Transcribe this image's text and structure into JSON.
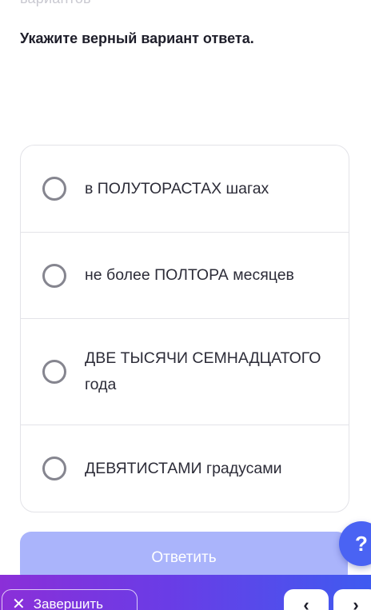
{
  "header": {
    "cut_text": "вариантов"
  },
  "question": {
    "prompt": "Укажите верный вариант ответа."
  },
  "answers": [
    {
      "label": "в ПОЛУТОРАСТАХ шагах"
    },
    {
      "label": "не более ПОЛТОРА месяцев"
    },
    {
      "label": "ДВЕ ТЫСЯЧИ СЕМНАДЦАТОГО года"
    },
    {
      "label": "ДЕВЯТИСТАМИ градусами"
    }
  ],
  "submit": {
    "label": "Ответить"
  },
  "help": {
    "label": "?"
  },
  "footer": {
    "finish_label": "Завершить",
    "prev_icon": "chevron-left-icon",
    "next_icon": "chevron-right-icon"
  },
  "colors": {
    "accent": "#4a63f3",
    "submit_disabled": "#aab4fb",
    "gradient_start": "#8b2fd8",
    "gradient_end": "#3f5bf0"
  }
}
